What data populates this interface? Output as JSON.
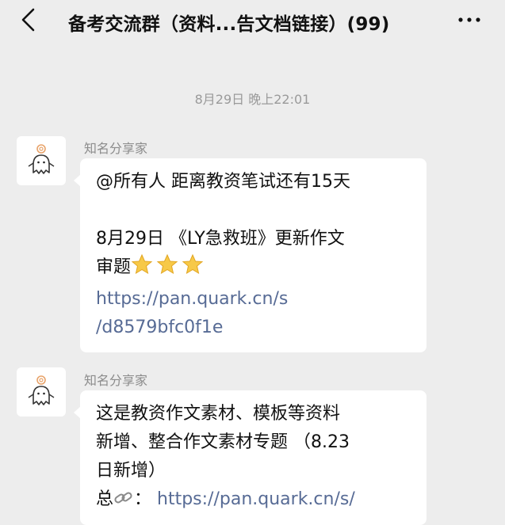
{
  "header": {
    "title": "备考交流群（资料...告文档链接）(99)"
  },
  "timestamp": "8月29日 晚上22:01",
  "messages": [
    {
      "sender": "知名分享家",
      "lines": {
        "l1": "@所有人 距离教资笔试还有15天",
        "l2": "8月29日 《LY急救班》更新作文",
        "l3": "审题",
        "l4": "https://pan.quark.cn/s",
        "l5": "/d8579bfc0f1e"
      },
      "stars": 3
    },
    {
      "sender": "知名分享家",
      "lines": {
        "l1": "这是教资作文素材、模板等资料",
        "l2": "新增、整合作文素材专题 （8.23",
        "l3": "日新增）",
        "l4_prefix": "总",
        "l4_link": "https://pan.quark.cn/s/"
      }
    }
  ],
  "icons": {
    "back": "chevron-left-icon",
    "more": "more-dots-icon",
    "star": "star-icon",
    "link": "link-icon"
  },
  "colors": {
    "background": "#ededed",
    "bubble": "#ffffff",
    "link": "#576b95",
    "star": "#f7c948"
  }
}
